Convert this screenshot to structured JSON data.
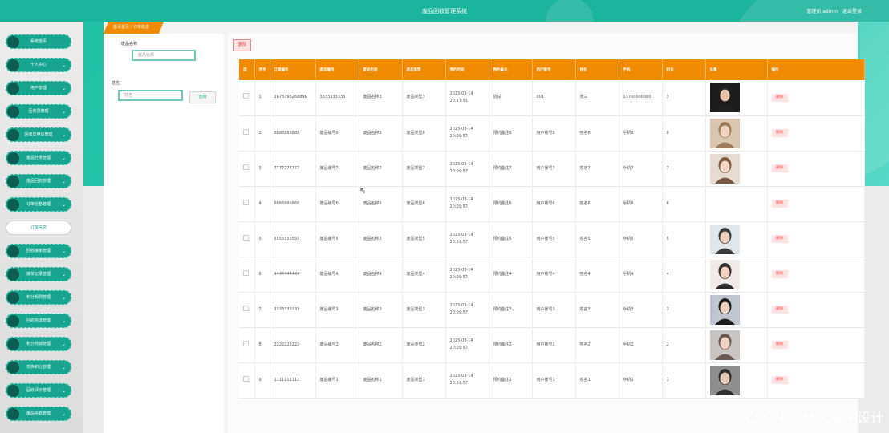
{
  "header": {
    "title": "废品回收管理系统",
    "user_text": "管理员 admin",
    "logout_label": "退出登录"
  },
  "sidebar": {
    "items": [
      {
        "label": "系统首页",
        "chev": ""
      },
      {
        "label": "个人中心",
        "chev": "⌄"
      },
      {
        "label": "用户管理",
        "chev": "⌄"
      },
      {
        "label": "回收员管理",
        "chev": "⌄"
      },
      {
        "label": "回收员申请管理",
        "chev": "⌄"
      },
      {
        "label": "废品分类管理",
        "chev": "⌄"
      },
      {
        "label": "废品回收管理",
        "chev": "⌄"
      },
      {
        "label": "订单信息管理",
        "chev": "⌄"
      },
      {
        "label": "订单信息",
        "chev": "",
        "sub": true
      },
      {
        "label": "回收接单管理",
        "chev": "⌄"
      },
      {
        "label": "接单记录管理",
        "chev": "⌄"
      },
      {
        "label": "积分规则管理",
        "chev": "⌄"
      },
      {
        "label": "回收完成管理",
        "chev": "⌄"
      },
      {
        "label": "积分商城管理",
        "chev": "⌄"
      },
      {
        "label": "兑换积分管理",
        "chev": "⌄"
      },
      {
        "label": "回收评价管理",
        "chev": "⌄"
      },
      {
        "label": "废品信息管理",
        "chev": "⌄"
      }
    ]
  },
  "breadcrumb": "首页首页 / 订单信息",
  "filters": {
    "name_label": "废品名称",
    "name_placeholder": "废品名称",
    "realname_label": "姓名",
    "realname_placeholder": "姓名",
    "query_label": "查询"
  },
  "toolbar": {
    "delete_label": "删除"
  },
  "table": {
    "headers": [
      "选",
      "序号",
      "订单编号",
      "废品编号",
      "废品名称",
      "废品类型",
      "预约时间",
      "预约备注",
      "用户账号",
      "姓名",
      "手机",
      "积分",
      "头像",
      "操作"
    ],
    "rows": [
      {
        "no": "1",
        "order": "1678796268896",
        "code": "3333333333",
        "name": "废品名称3",
        "type": "废品类型3",
        "time": "2023-03-14 20:17:51",
        "remark": "尝试",
        "account": "001",
        "person": "张三",
        "phone": "13700000000",
        "points": "3",
        "avatar": "a1",
        "action": "删除"
      },
      {
        "no": "2",
        "order": "8888888888",
        "code": "废品编号8",
        "name": "废品名称8",
        "type": "废品类型8",
        "time": "2023-03-14 20:09:57",
        "remark": "预约备注8",
        "account": "用户账号8",
        "person": "姓名8",
        "phone": "手机8",
        "points": "8",
        "avatar": "a2",
        "action": "删除"
      },
      {
        "no": "3",
        "order": "7777777777",
        "code": "废品编号7",
        "name": "废品名称7",
        "type": "废品类型7",
        "time": "2023-03-14 20:09:57",
        "remark": "预约备注7",
        "account": "用户账号7",
        "person": "姓名7",
        "phone": "手机7",
        "points": "7",
        "avatar": "a3",
        "action": "删除"
      },
      {
        "no": "4",
        "order": "6666666666",
        "code": "废品编号6",
        "name": "废品名称6",
        "type": "废品类型6",
        "time": "2023-03-14 20:09:57",
        "remark": "预约备注6",
        "account": "用户账号6",
        "person": "姓名6",
        "phone": "手机6",
        "points": "6",
        "avatar": "",
        "action": "删除"
      },
      {
        "no": "5",
        "order": "5555555555",
        "code": "废品编号5",
        "name": "废品名称5",
        "type": "废品类型5",
        "time": "2023-03-14 20:09:57",
        "remark": "预约备注5",
        "account": "用户账号5",
        "person": "姓名5",
        "phone": "手机5",
        "points": "5",
        "avatar": "a5",
        "action": "删除"
      },
      {
        "no": "6",
        "order": "4444444444",
        "code": "废品编号4",
        "name": "废品名称4",
        "type": "废品类型4",
        "time": "2023-03-14 20:09:57",
        "remark": "预约备注4",
        "account": "用户账号4",
        "person": "姓名4",
        "phone": "手机4",
        "points": "4",
        "avatar": "a6",
        "action": "删除"
      },
      {
        "no": "7",
        "order": "3333333333",
        "code": "废品编号3",
        "name": "废品名称3",
        "type": "废品类型3",
        "time": "2023-03-14 20:09:57",
        "remark": "预约备注3",
        "account": "用户账号3",
        "person": "姓名3",
        "phone": "手机3",
        "points": "3",
        "avatar": "a7",
        "action": "删除"
      },
      {
        "no": "8",
        "order": "2222222222",
        "code": "废品编号2",
        "name": "废品名称2",
        "type": "废品类型2",
        "time": "2023-03-14 20:09:57",
        "remark": "预约备注2",
        "account": "用户账号2",
        "person": "姓名2",
        "phone": "手机2",
        "points": "2",
        "avatar": "a8",
        "action": "删除"
      },
      {
        "no": "9",
        "order": "1111111111",
        "code": "废品编号1",
        "name": "废品名称1",
        "type": "废品类型1",
        "time": "2023-03-14 20:09:57",
        "remark": "预约备注1",
        "account": "用户账号1",
        "person": "姓名1",
        "phone": "手机1",
        "points": "1",
        "avatar": "a9",
        "action": "删除"
      }
    ]
  },
  "watermark": "CSDN @林文程序设计",
  "colors": {
    "primary": "#1ab39b",
    "accent": "#f08a00",
    "danger": "#e44444"
  }
}
